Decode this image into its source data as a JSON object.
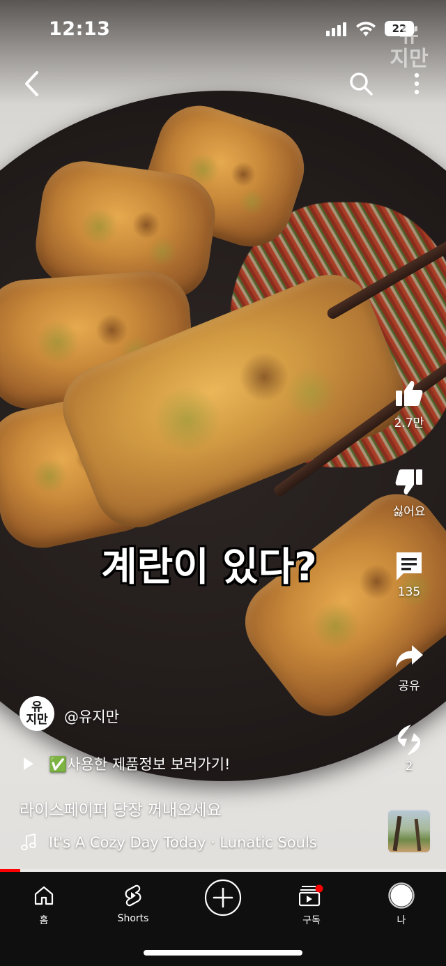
{
  "status_bar": {
    "time": "12:13",
    "battery": "22"
  },
  "watermark": "유\n지만",
  "top_bar": {
    "back_icon": "chevron-left-icon",
    "search_icon": "search-icon",
    "more_icon": "more-vertical-icon"
  },
  "caption": "계란이 있다?",
  "actions": {
    "like_count": "2.7만",
    "dislike_label": "싫어요",
    "comment_count": "135",
    "share_label": "공유",
    "remix_count": "2"
  },
  "channel": {
    "avatar_text": "유\n지만",
    "handle": "@유지만"
  },
  "link": {
    "text": "✅사용한 제품정보 보러가기!"
  },
  "video_title": "라이스페이퍼 당장 꺼내오세요",
  "music": {
    "text": "It's A Cozy Day Today · Lunatic Souls"
  },
  "progress": {
    "fraction": 0.045,
    "color": "#ff0000"
  },
  "nav": {
    "items": [
      {
        "label": "홈",
        "icon": "home-icon"
      },
      {
        "label": "Shorts",
        "icon": "shorts-icon"
      },
      {
        "label": "",
        "icon": "create-plus-icon"
      },
      {
        "label": "구독",
        "icon": "subscriptions-icon"
      },
      {
        "label": "나",
        "icon": "profile-avatar-icon"
      }
    ]
  }
}
